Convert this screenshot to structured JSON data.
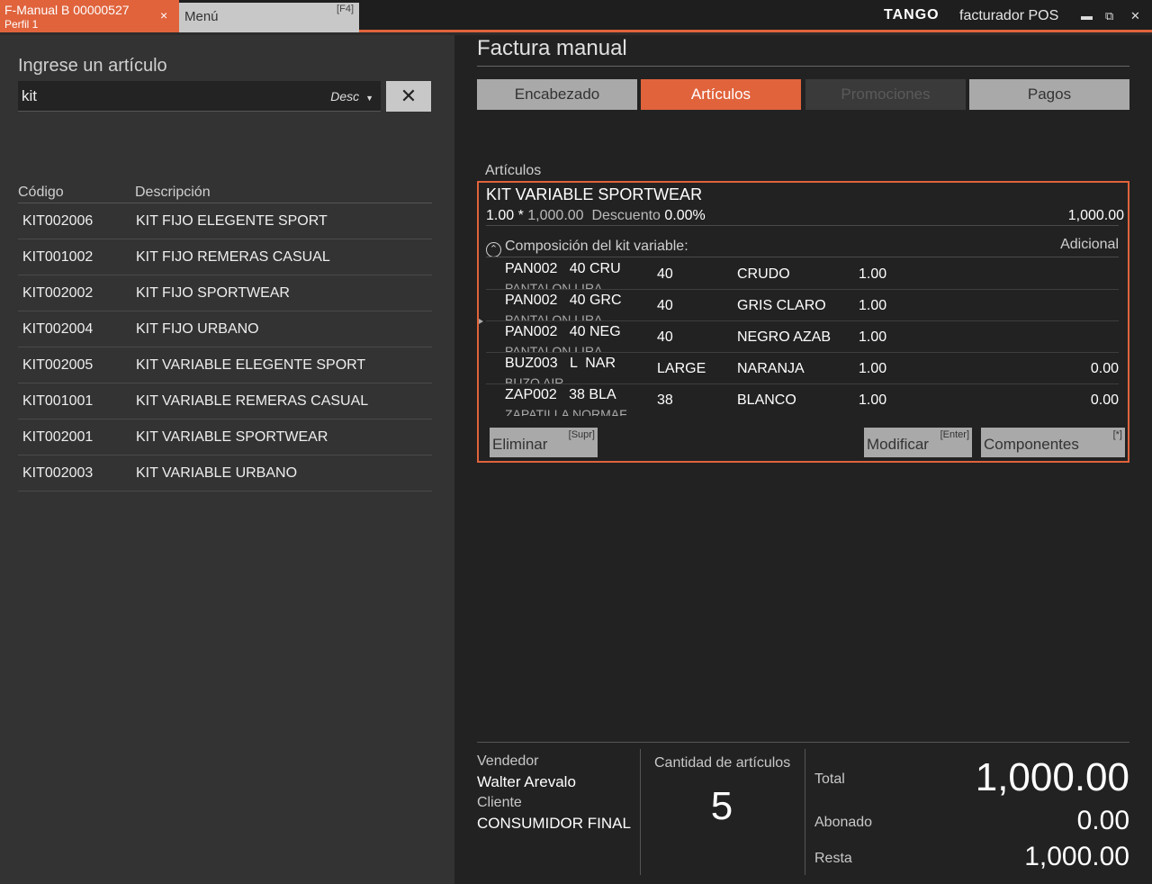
{
  "titlebar": {
    "active_tab": {
      "title": "F-Manual B 00000527",
      "subtitle": "Perfil 1",
      "close": "×"
    },
    "menu_tab": {
      "label": "Menú",
      "shortcut": "[F4]"
    },
    "brand": "TANGO",
    "product": "facturador POS",
    "minimize": "▬",
    "maximize": "⧉",
    "close": "✕"
  },
  "search": {
    "title": "Ingrese un artículo",
    "value": "kit",
    "mode": "Desc",
    "clear": "✕"
  },
  "results": {
    "headers": {
      "code": "Código",
      "description": "Descripción"
    },
    "rows": [
      {
        "code": "KIT002006",
        "description": "KIT FIJO ELEGENTE SPORT"
      },
      {
        "code": "KIT001002",
        "description": "KIT FIJO REMERAS CASUAL"
      },
      {
        "code": "KIT002002",
        "description": "KIT FIJO SPORTWEAR"
      },
      {
        "code": "KIT002004",
        "description": "KIT FIJO URBANO"
      },
      {
        "code": "KIT002005",
        "description": "KIT VARIABLE ELEGENTE SPORT"
      },
      {
        "code": "KIT001001",
        "description": "KIT VARIABLE REMERAS CASUAL"
      },
      {
        "code": "KIT002001",
        "description": "KIT VARIABLE SPORTWEAR"
      },
      {
        "code": "KIT002003",
        "description": "KIT VARIABLE URBANO"
      }
    ]
  },
  "main": {
    "title": "Factura manual",
    "tabs": [
      {
        "label": "Encabezado",
        "state": "normal"
      },
      {
        "label": "Artículos",
        "state": "active"
      },
      {
        "label": "Promociones",
        "state": "disabled"
      },
      {
        "label": "Pagos",
        "state": "normal"
      }
    ],
    "section_label": "Artículos",
    "item": {
      "name": "KIT VARIABLE SPORTWEAR",
      "qty": "1.00",
      "times": "*",
      "unit_price": "1,000.00",
      "discount_label": "Descuento",
      "discount": "0.00%",
      "total": "1,000.00",
      "composition_title": "Composición del kit variable:",
      "additional_label": "Adicional",
      "components": [
        {
          "code": "PAN002   40 CRU",
          "desc": "PANTALON LIRA",
          "size": "40",
          "color": "CRUDO",
          "qty": "1.00",
          "additional": ""
        },
        {
          "code": "PAN002   40 GRC",
          "desc": "PANTALON LIRA",
          "size": "40",
          "color": "GRIS CLARO",
          "qty": "1.00",
          "additional": ""
        },
        {
          "code": "PAN002   40 NEG",
          "desc": "PANTALON LIRA",
          "size": "40",
          "color": "NEGRO AZAB",
          "qty": "1.00",
          "additional": ""
        },
        {
          "code": "BUZ003   L  NAR",
          "desc": "BUZO AIR",
          "size": "LARGE",
          "color": "NARANJA",
          "qty": "1.00",
          "additional": "0.00"
        },
        {
          "code": "ZAP002   38 BLA",
          "desc": "ZAPATILLA NORMAF",
          "size": "38",
          "color": "BLANCO",
          "qty": "1.00",
          "additional": "0.00"
        }
      ],
      "buttons": {
        "delete": {
          "label": "Eliminar",
          "key": "[Supr]"
        },
        "modify": {
          "label": "Modificar",
          "key": "[Enter]"
        },
        "components": {
          "label": "Componentes",
          "key": "[*]"
        }
      }
    }
  },
  "footer": {
    "seller_label": "Vendedor",
    "seller": "Walter Arevalo",
    "client_label": "Cliente",
    "client": "CONSUMIDOR FINAL",
    "items_count_label": "Cantidad de artículos",
    "items_count": "5",
    "total_label": "Total",
    "total": "1,000.00",
    "paid_label": "Abonado",
    "paid": "0.00",
    "remaining_label": "Resta",
    "remaining": "1,000.00"
  },
  "colors": {
    "accent": "#e0633c",
    "panel_left": "#333333",
    "panel_right": "#222222"
  }
}
